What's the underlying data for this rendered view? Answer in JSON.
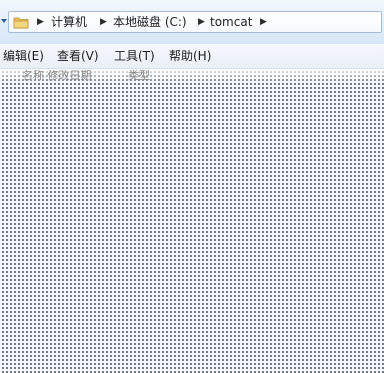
{
  "address_bar": {
    "crumbs": [
      "计算机",
      "本地磁盘 (C:)",
      "tomcat"
    ]
  },
  "menu": {
    "items": [
      "编辑(E)",
      "查看(V)",
      "工具(T)",
      "帮助(H)"
    ]
  },
  "list_header": {
    "partial_labels": [
      "名称  修改日期",
      "类型"
    ]
  },
  "icons": {
    "folder": "folder-icon",
    "separator": "breadcrumb-arrow-icon"
  },
  "colors": {
    "addr_bg": "#e4eefa",
    "content_dots": "#3c4a5c",
    "folder": "#e8c35a"
  }
}
